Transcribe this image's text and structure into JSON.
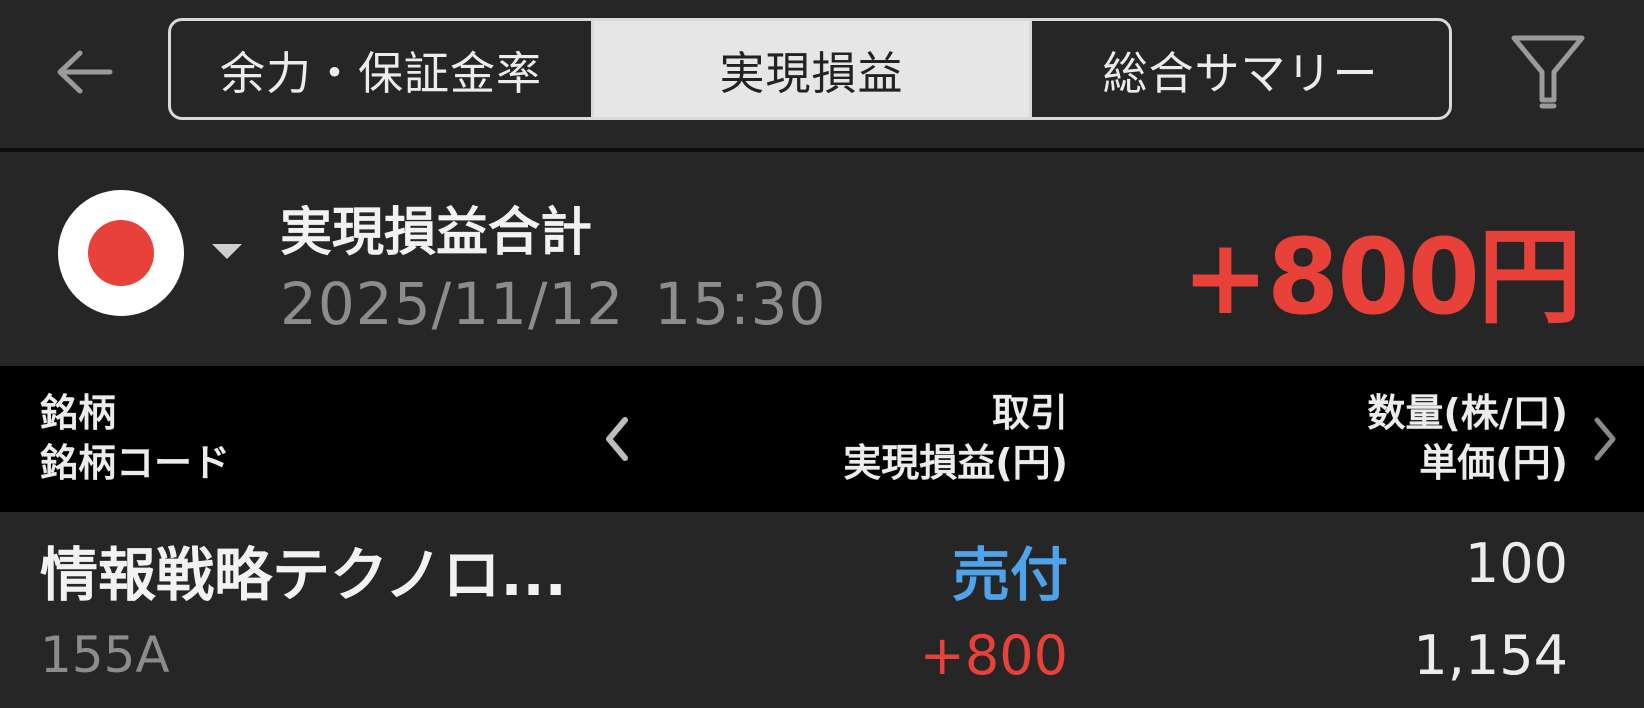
{
  "header": {
    "back_icon": "arrow-left-icon",
    "tabs": [
      {
        "label": "余力・保証金率",
        "active": false
      },
      {
        "label": "実現損益",
        "active": true
      },
      {
        "label": "総合サマリー",
        "active": false
      }
    ],
    "filter_icon": "filter-icon"
  },
  "summary": {
    "market_flag": "japan-flag-icon",
    "title": "実現損益合計",
    "date": "2025/11/12",
    "time": "15:30",
    "total": "+800円",
    "total_color": "#e8413a"
  },
  "table": {
    "headers": {
      "col1_line1": "銘柄",
      "col1_line2": "銘柄コード",
      "col2_line1": "取引",
      "col2_line2": "実現損益(円)",
      "col3_line1": "数量(株/口)",
      "col3_line2": "単価(円)"
    },
    "rows": [
      {
        "name": "情報戦略テクノロ...",
        "code": "155A",
        "side": "売付",
        "side_color": "#4ea3ea",
        "realized_pl": "+800",
        "pl_color": "#e8413a",
        "quantity": "100",
        "unit_price": "1,154"
      }
    ]
  },
  "colors": {
    "background": "#262626",
    "header_bar": "#000000",
    "accent_red": "#e8413a",
    "accent_blue": "#4ea3ea"
  }
}
